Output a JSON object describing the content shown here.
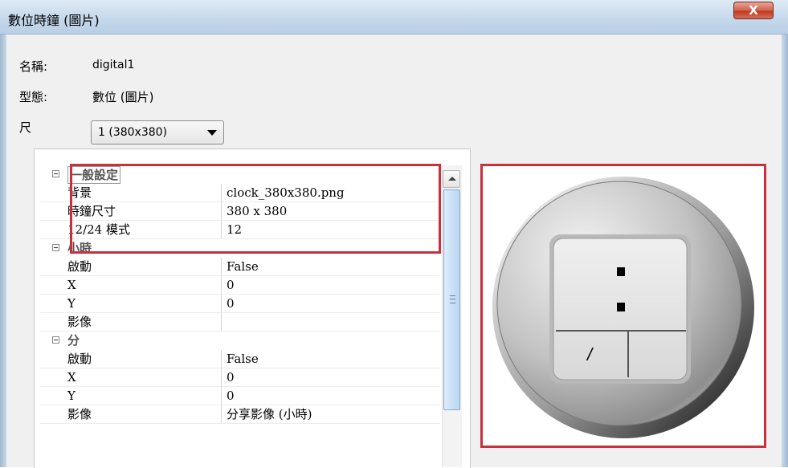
{
  "window": {
    "title": "數位時鐘 (圖片)",
    "close_label": "X"
  },
  "fields": {
    "name_label": "名稱:",
    "name_value": "digital1",
    "type_label": "型態:",
    "type_value": "數位 (圖片)",
    "size_label": "尺",
    "size_selected": "1 (380x380)"
  },
  "property_grid": {
    "general": {
      "title": "一般設定",
      "rows": [
        {
          "key": "背景",
          "value": "clock_380x380.png"
        },
        {
          "key": "時鐘尺寸",
          "value": "380 x 380"
        },
        {
          "key": "12/24 模式",
          "value": "12"
        }
      ]
    },
    "hour": {
      "title": "小時",
      "rows": [
        {
          "key": "啟動",
          "value": "False"
        },
        {
          "key": "X",
          "value": "0"
        },
        {
          "key": "Y",
          "value": "0"
        },
        {
          "key": "影像",
          "value": ""
        }
      ]
    },
    "minute": {
      "title": "分",
      "rows": [
        {
          "key": "啟動",
          "value": "False"
        },
        {
          "key": "X",
          "value": "0"
        },
        {
          "key": "Y",
          "value": "0"
        },
        {
          "key": "影像",
          "value": "分享影像 (小時)"
        }
      ]
    }
  },
  "preview": {
    "slash_glyph": "/"
  },
  "colors": {
    "highlight": "#c8303c",
    "close_button": "#c0391f"
  }
}
